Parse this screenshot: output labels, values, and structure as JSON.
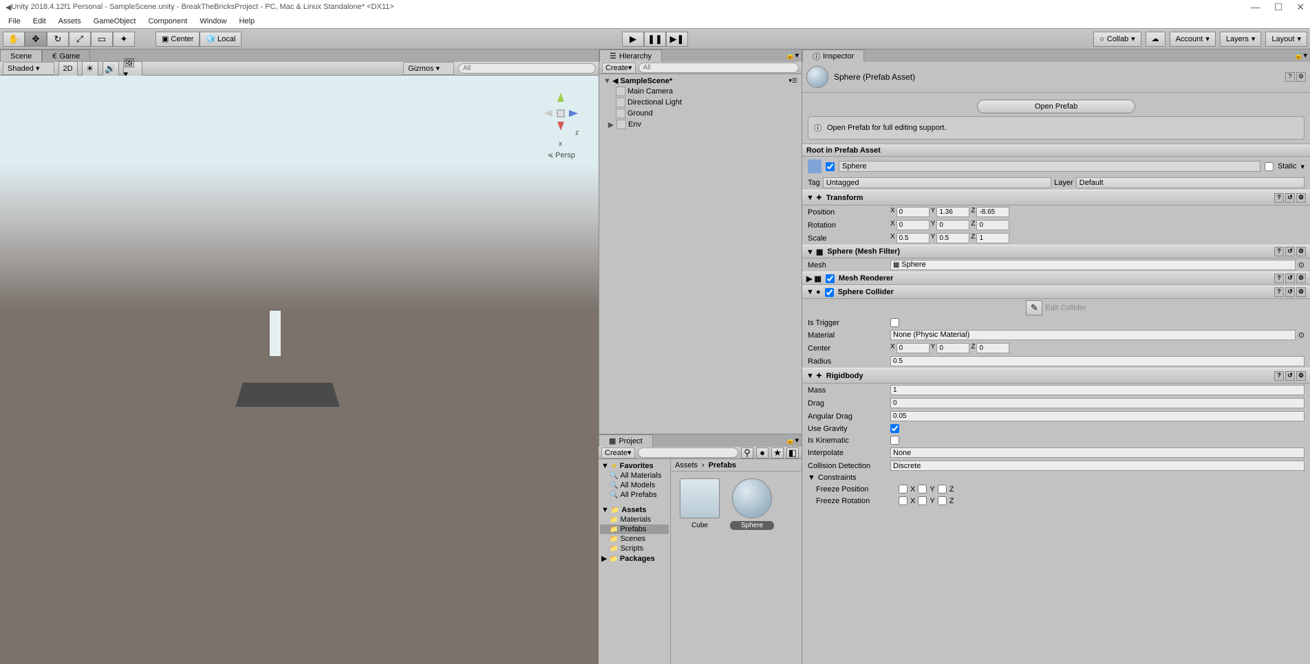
{
  "window": {
    "title": "Unity 2018.4.12f1 Personal - SampleScene.unity - BreakTheBricksProject - PC, Mac & Linux Standalone* <DX11>"
  },
  "menu": [
    "File",
    "Edit",
    "Assets",
    "GameObject",
    "Component",
    "Window",
    "Help"
  ],
  "toolbar": {
    "pivot_center": "Center",
    "pivot_local": "Local",
    "collab": "Collab",
    "account": "Account",
    "layers": "Layers",
    "layout": "Layout"
  },
  "scene": {
    "tab_scene": "Scene",
    "tab_game": "Game",
    "shaded": "Shaded",
    "mode_2d": "2D",
    "gizmos_label": "Gizmos",
    "search_placeholder": "All",
    "persp_label": "Persp",
    "axis_x": "x",
    "axis_z": "z"
  },
  "hierarchy": {
    "title": "Hierarchy",
    "create": "Create",
    "search_placeholder": "All",
    "scene_name": "SampleScene*",
    "items": [
      "Main Camera",
      "Directional Light",
      "Ground",
      "Env"
    ]
  },
  "project": {
    "title": "Project",
    "create": "Create",
    "favorites": "Favorites",
    "fav_items": [
      "All Materials",
      "All Models",
      "All Prefabs"
    ],
    "assets": "Assets",
    "asset_folders": [
      "Materials",
      "Prefabs",
      "Scenes",
      "Scripts"
    ],
    "packages": "Packages",
    "breadcrumb_assets": "Assets",
    "breadcrumb_prefabs": "Prefabs",
    "items": [
      {
        "name": "Cube",
        "selected": false
      },
      {
        "name": "Sphere",
        "selected": true
      }
    ]
  },
  "inspector": {
    "title": "Inspector",
    "asset_name": "Sphere (Prefab Asset)",
    "open_prefab": "Open Prefab",
    "info_text": "Open Prefab for full editing support.",
    "root_title": "Root in Prefab Asset",
    "object_name": "Sphere",
    "static_label": "Static",
    "tag_label": "Tag",
    "tag_value": "Untagged",
    "layer_label": "Layer",
    "layer_value": "Default",
    "transform": {
      "title": "Transform",
      "position_label": "Position",
      "position": {
        "x": "0",
        "y": "1.36",
        "z": "-8.65"
      },
      "rotation_label": "Rotation",
      "rotation": {
        "x": "0",
        "y": "0",
        "z": "0"
      },
      "scale_label": "Scale",
      "scale": {
        "x": "0.5",
        "y": "0.5",
        "z": "1"
      }
    },
    "mesh_filter": {
      "title": "Sphere (Mesh Filter)",
      "mesh_label": "Mesh",
      "mesh_value": "Sphere"
    },
    "mesh_renderer": {
      "title": "Mesh Renderer"
    },
    "sphere_collider": {
      "title": "Sphere Collider",
      "edit_collider": "Edit Collider",
      "is_trigger": "Is Trigger",
      "material_label": "Material",
      "material_value": "None (Physic Material)",
      "center_label": "Center",
      "center": {
        "x": "0",
        "y": "0",
        "z": "0"
      },
      "radius_label": "Radius",
      "radius": "0.5"
    },
    "rigidbody": {
      "title": "Rigidbody",
      "mass_label": "Mass",
      "mass": "1",
      "drag_label": "Drag",
      "drag": "0",
      "angular_drag_label": "Angular Drag",
      "angular_drag": "0.05",
      "use_gravity_label": "Use Gravity",
      "use_gravity": true,
      "is_kinematic_label": "Is Kinematic",
      "is_kinematic": false,
      "interpolate_label": "Interpolate",
      "interpolate": "None",
      "collision_detection_label": "Collision Detection",
      "collision_detection": "Discrete",
      "constraints_label": "Constraints",
      "freeze_position_label": "Freeze Position",
      "freeze_rotation_label": "Freeze Rotation",
      "axis_x": "X",
      "axis_y": "Y",
      "axis_z": "Z"
    }
  }
}
